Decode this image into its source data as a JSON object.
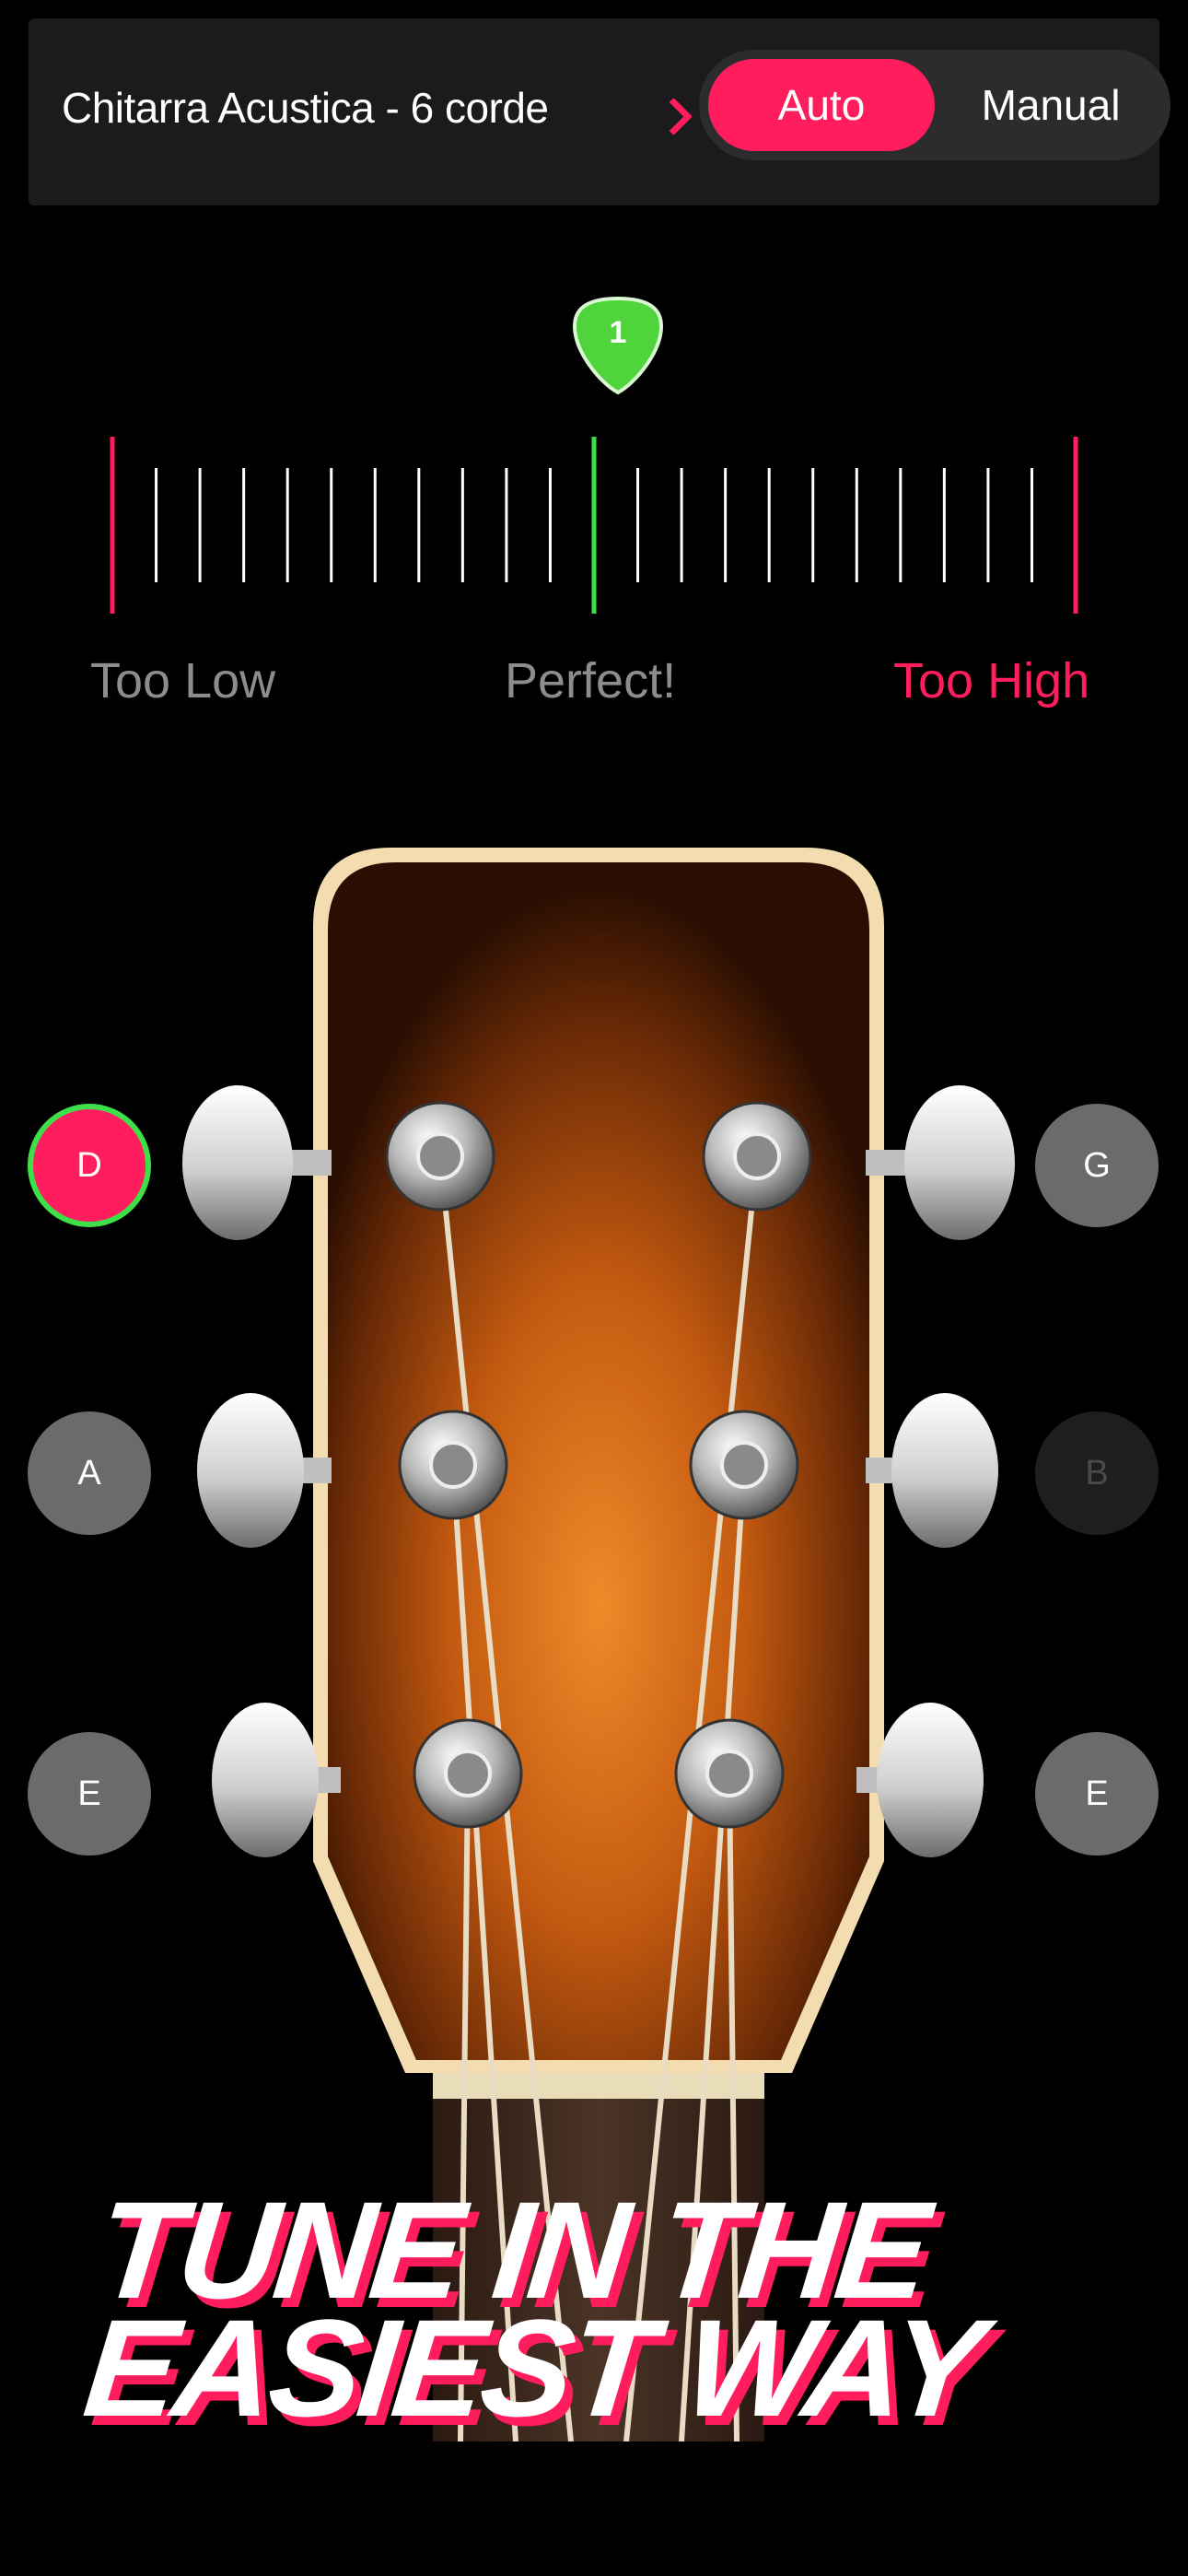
{
  "topbar": {
    "instrument_label": "Chitarra Acustica - 6 corde",
    "mode_auto_label": "Auto",
    "mode_manual_label": "Manual",
    "selected_mode": "Auto"
  },
  "tuner": {
    "string_number": "1",
    "labels": {
      "low": "Too Low",
      "perfect": "Perfect!",
      "high": "Too High"
    },
    "colors": {
      "accent": "#ff1d5e",
      "in_tune": "#3ee04a"
    }
  },
  "strings": {
    "left": [
      {
        "note": "D",
        "state": "active"
      },
      {
        "note": "A",
        "state": "normal"
      },
      {
        "note": "E",
        "state": "normal"
      }
    ],
    "right": [
      {
        "note": "G",
        "state": "normal"
      },
      {
        "note": "B",
        "state": "disabled"
      },
      {
        "note": "E",
        "state": "normal"
      }
    ]
  },
  "headline": {
    "line1": "TUNE IN THE",
    "line2": "EASIEST WAY"
  }
}
